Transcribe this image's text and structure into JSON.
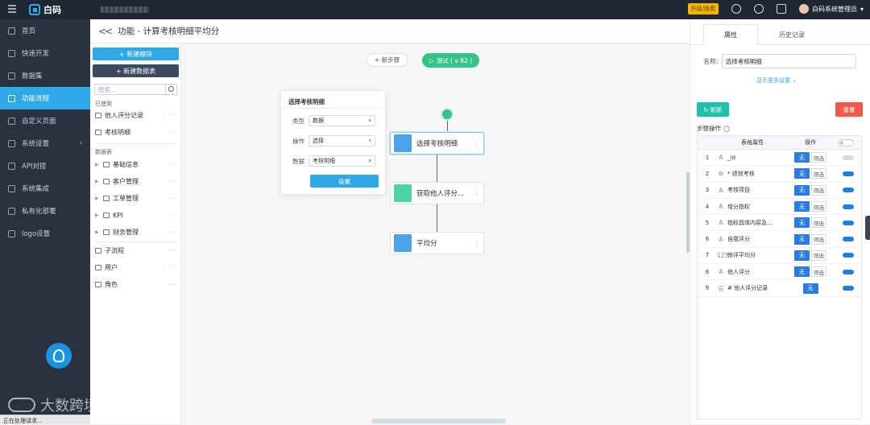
{
  "app": {
    "logo_text": "白码",
    "upgrade_label": "升级/续费",
    "user_name": "白码系统管理员"
  },
  "sidebar": {
    "items": [
      {
        "label": "首页",
        "icon": "home-icon"
      },
      {
        "label": "快速开发",
        "icon": "cube-icon"
      },
      {
        "label": "数据集",
        "icon": "database-icon"
      },
      {
        "label": "功能流程",
        "icon": "flow-icon"
      },
      {
        "label": "自定义页面",
        "icon": "page-icon"
      },
      {
        "label": "系统设置",
        "icon": "settings-icon"
      },
      {
        "label": "API对接",
        "icon": "api-icon"
      },
      {
        "label": "系统集成",
        "icon": "integration-icon"
      },
      {
        "label": "私有化部署",
        "icon": "server-icon"
      },
      {
        "label": "logo设置",
        "icon": "logo-icon"
      }
    ],
    "active_index": 3,
    "watermark": "大数跨境",
    "status_text": "正在处理请求..."
  },
  "title": {
    "back_icon": "double-chevron-left-icon",
    "text": "功能 - 计算考核明细平均分"
  },
  "left_panel": {
    "new_module": "+ 新建模块",
    "new_dataset": "+ 新建数据表",
    "search_placeholder": "搜索...",
    "used_label": "已使用",
    "used_items": [
      "他人评分记录",
      "考核明细"
    ],
    "datatable_label": "数据表",
    "folders": [
      "基础信息",
      "客户管理",
      "工单管理",
      "KPI",
      "财务管理"
    ],
    "other_items": [
      "子流程",
      "用户",
      "角色"
    ]
  },
  "canvas": {
    "add_step": "+ 新步骤",
    "test_label": "测试 ( v 82 )",
    "popover": {
      "title": "选择考核明细",
      "rows": [
        {
          "label": "类型",
          "value": "数据"
        },
        {
          "label": "操作",
          "value": "选择"
        },
        {
          "label": "数据",
          "value": "考核明细"
        }
      ],
      "button": "设置"
    },
    "steps": [
      "选择考核明细",
      "获取他人评分...",
      "平均分"
    ]
  },
  "right_panel": {
    "tabs": [
      "属性",
      "历史记录"
    ],
    "name_label": "名称:",
    "name_value": "选择考核明细",
    "show_more": "显示更多设置 ⌄",
    "refresh": "刷新",
    "reset": "重置",
    "ops_label": "步骤操作",
    "col_attr": "表格属性",
    "col_ops": "操作",
    "none_label": "无",
    "filter_label": "筛选",
    "rows": [
      {
        "idx": "1",
        "type": "A",
        "name": "_id",
        "filter": true,
        "on": false
      },
      {
        "idx": "2",
        "type": "⧉",
        "name": "* 绩效考核",
        "filter": true,
        "on": true
      },
      {
        "idx": "3",
        "type": "A",
        "name": "考核项目",
        "filter": true,
        "on": true
      },
      {
        "idx": "4",
        "type": "A",
        "name": "增分指标",
        "filter": true,
        "on": true
      },
      {
        "idx": "5",
        "type": "A",
        "name": "指标具体内容及...",
        "filter": true,
        "on": true
      },
      {
        "idx": "6",
        "type": "A",
        "name": "自我评分",
        "filter": true,
        "on": true
      },
      {
        "idx": "7",
        "type": "123",
        "name": "他评平均分",
        "filter": true,
        "on": true
      },
      {
        "idx": "8",
        "type": "A",
        "name": "他人评分",
        "filter": true,
        "on": true
      },
      {
        "idx": "9",
        "type": "☰",
        "name": "# 他人评分记录",
        "filter": false,
        "on": true
      }
    ]
  },
  "colors": {
    "accent": "#2ea8e6",
    "sidebar_bg": "#2a3240",
    "green": "#36c38a",
    "refresh": "#1fbfa8",
    "reset": "#f0584a"
  }
}
